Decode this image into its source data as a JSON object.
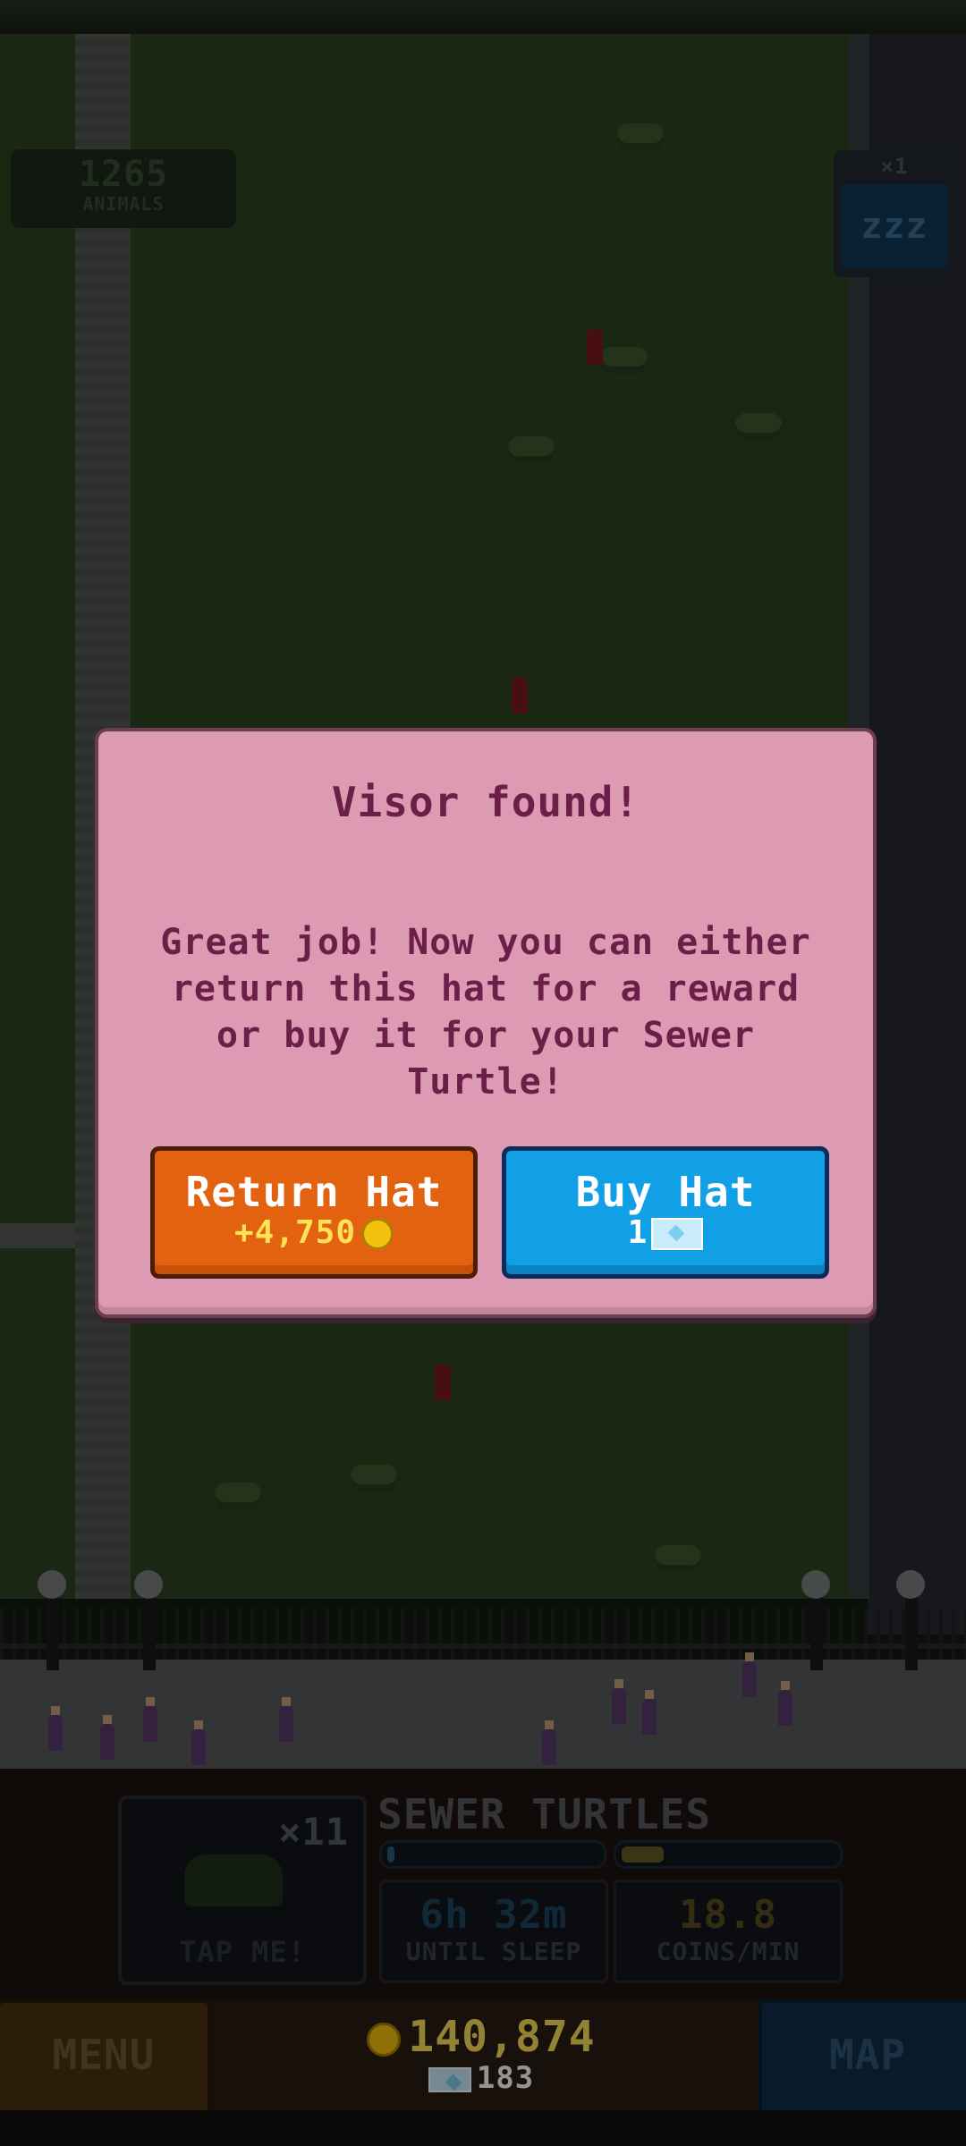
{
  "hud": {
    "animal_count": "1265",
    "animal_label": "ANIMALS",
    "sleep_multiplier": "×1",
    "sleep_icon": "zzz"
  },
  "modal": {
    "title": "Visor found!",
    "message_lines": [
      "Great job! Now you can either",
      "return this hat for a reward",
      "or buy it for your Sewer Turtle!"
    ],
    "return_button": {
      "label": "Return Hat",
      "reward": "+4,750",
      "icon": "coin-icon"
    },
    "buy_button": {
      "label": "Buy Hat",
      "price": "1",
      "icon": "gem-icon"
    }
  },
  "species_panel": {
    "name": "SEWER TURTLES",
    "tap_multiplier": "×11",
    "tap_label": "TAP ME!",
    "sleep_progress": 0.03,
    "coin_progress": 0.2,
    "sleep_value": "6h 32m",
    "sleep_label": "UNTIL SLEEP",
    "coins_value": "18.8",
    "coins_label": "COINS/MIN"
  },
  "bottom_bar": {
    "menu_label": "MENU",
    "map_label": "MAP",
    "coins": "140,874",
    "gems": "183"
  },
  "colors": {
    "modal_bg": "#dc9bb2",
    "modal_text": "#6b1f48",
    "return_button": "#e2620f",
    "buy_button": "#11a0e6",
    "coin_text": "#ffe15a"
  }
}
